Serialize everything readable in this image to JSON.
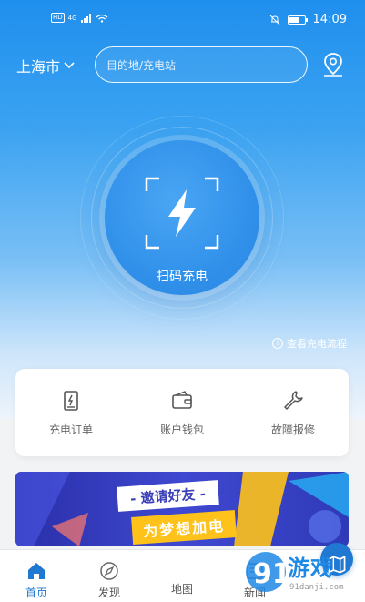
{
  "status_bar": {
    "network": "4G",
    "time": "14:09"
  },
  "header": {
    "city": "上海市",
    "search_placeholder": "目的地/充电站"
  },
  "scan": {
    "label": "扫码充电"
  },
  "flow_link": "查看充电流程",
  "quick_actions": [
    {
      "label": "充电订单",
      "icon": "order-icon"
    },
    {
      "label": "账户钱包",
      "icon": "wallet-icon"
    },
    {
      "label": "故障报修",
      "icon": "wrench-icon"
    }
  ],
  "banner": {
    "line1": "- 邀请好友 -",
    "line2": "为梦想加电"
  },
  "bottom_nav": [
    {
      "label": "首页",
      "icon": "home-icon",
      "active": true
    },
    {
      "label": "发现",
      "icon": "compass-icon",
      "active": false
    },
    {
      "label": "地图",
      "icon": "map-icon",
      "active": false
    },
    {
      "label": "新闻",
      "icon": "news-icon",
      "active": false
    }
  ],
  "watermark": {
    "brand": "游戏",
    "url": "91danji.com"
  },
  "colors": {
    "primary": "#1f78d1",
    "hero_top": "#1f8fee",
    "accent": "#ffc21a"
  }
}
